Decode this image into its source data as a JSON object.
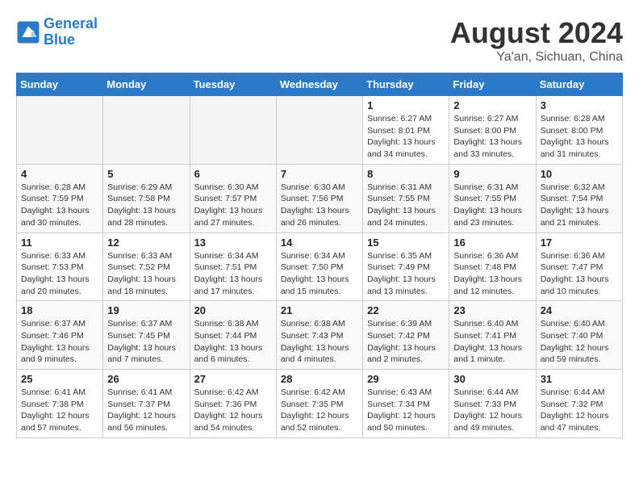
{
  "logo": {
    "line1": "General",
    "line2": "Blue"
  },
  "title": "August 2024",
  "subtitle": "Ya'an, Sichuan, China",
  "days_of_week": [
    "Sunday",
    "Monday",
    "Tuesday",
    "Wednesday",
    "Thursday",
    "Friday",
    "Saturday"
  ],
  "weeks": [
    [
      {
        "day": "",
        "empty": true
      },
      {
        "day": "",
        "empty": true
      },
      {
        "day": "",
        "empty": true
      },
      {
        "day": "",
        "empty": true
      },
      {
        "day": "1",
        "sunrise": "6:27 AM",
        "sunset": "8:01 PM",
        "daylight": "13 hours and 34 minutes."
      },
      {
        "day": "2",
        "sunrise": "6:27 AM",
        "sunset": "8:00 PM",
        "daylight": "13 hours and 33 minutes."
      },
      {
        "day": "3",
        "sunrise": "6:28 AM",
        "sunset": "8:00 PM",
        "daylight": "13 hours and 31 minutes."
      }
    ],
    [
      {
        "day": "4",
        "sunrise": "6:28 AM",
        "sunset": "7:59 PM",
        "daylight": "13 hours and 30 minutes."
      },
      {
        "day": "5",
        "sunrise": "6:29 AM",
        "sunset": "7:58 PM",
        "daylight": "13 hours and 28 minutes."
      },
      {
        "day": "6",
        "sunrise": "6:30 AM",
        "sunset": "7:57 PM",
        "daylight": "13 hours and 27 minutes."
      },
      {
        "day": "7",
        "sunrise": "6:30 AM",
        "sunset": "7:56 PM",
        "daylight": "13 hours and 26 minutes."
      },
      {
        "day": "8",
        "sunrise": "6:31 AM",
        "sunset": "7:55 PM",
        "daylight": "13 hours and 24 minutes."
      },
      {
        "day": "9",
        "sunrise": "6:31 AM",
        "sunset": "7:55 PM",
        "daylight": "13 hours and 23 minutes."
      },
      {
        "day": "10",
        "sunrise": "6:32 AM",
        "sunset": "7:54 PM",
        "daylight": "13 hours and 21 minutes."
      }
    ],
    [
      {
        "day": "11",
        "sunrise": "6:33 AM",
        "sunset": "7:53 PM",
        "daylight": "13 hours and 20 minutes."
      },
      {
        "day": "12",
        "sunrise": "6:33 AM",
        "sunset": "7:52 PM",
        "daylight": "13 hours and 18 minutes."
      },
      {
        "day": "13",
        "sunrise": "6:34 AM",
        "sunset": "7:51 PM",
        "daylight": "13 hours and 17 minutes."
      },
      {
        "day": "14",
        "sunrise": "6:34 AM",
        "sunset": "7:50 PM",
        "daylight": "13 hours and 15 minutes."
      },
      {
        "day": "15",
        "sunrise": "6:35 AM",
        "sunset": "7:49 PM",
        "daylight": "13 hours and 13 minutes."
      },
      {
        "day": "16",
        "sunrise": "6:36 AM",
        "sunset": "7:48 PM",
        "daylight": "13 hours and 12 minutes."
      },
      {
        "day": "17",
        "sunrise": "6:36 AM",
        "sunset": "7:47 PM",
        "daylight": "13 hours and 10 minutes."
      }
    ],
    [
      {
        "day": "18",
        "sunrise": "6:37 AM",
        "sunset": "7:46 PM",
        "daylight": "13 hours and 9 minutes."
      },
      {
        "day": "19",
        "sunrise": "6:37 AM",
        "sunset": "7:45 PM",
        "daylight": "13 hours and 7 minutes."
      },
      {
        "day": "20",
        "sunrise": "6:38 AM",
        "sunset": "7:44 PM",
        "daylight": "13 hours and 6 minutes."
      },
      {
        "day": "21",
        "sunrise": "6:38 AM",
        "sunset": "7:43 PM",
        "daylight": "13 hours and 4 minutes."
      },
      {
        "day": "22",
        "sunrise": "6:39 AM",
        "sunset": "7:42 PM",
        "daylight": "13 hours and 2 minutes."
      },
      {
        "day": "23",
        "sunrise": "6:40 AM",
        "sunset": "7:41 PM",
        "daylight": "13 hours and 1 minute."
      },
      {
        "day": "24",
        "sunrise": "6:40 AM",
        "sunset": "7:40 PM",
        "daylight": "12 hours and 59 minutes."
      }
    ],
    [
      {
        "day": "25",
        "sunrise": "6:41 AM",
        "sunset": "7:38 PM",
        "daylight": "12 hours and 57 minutes."
      },
      {
        "day": "26",
        "sunrise": "6:41 AM",
        "sunset": "7:37 PM",
        "daylight": "12 hours and 56 minutes."
      },
      {
        "day": "27",
        "sunrise": "6:42 AM",
        "sunset": "7:36 PM",
        "daylight": "12 hours and 54 minutes."
      },
      {
        "day": "28",
        "sunrise": "6:42 AM",
        "sunset": "7:35 PM",
        "daylight": "12 hours and 52 minutes."
      },
      {
        "day": "29",
        "sunrise": "6:43 AM",
        "sunset": "7:34 PM",
        "daylight": "12 hours and 50 minutes."
      },
      {
        "day": "30",
        "sunrise": "6:44 AM",
        "sunset": "7:33 PM",
        "daylight": "12 hours and 49 minutes."
      },
      {
        "day": "31",
        "sunrise": "6:44 AM",
        "sunset": "7:32 PM",
        "daylight": "12 hours and 47 minutes."
      }
    ]
  ]
}
